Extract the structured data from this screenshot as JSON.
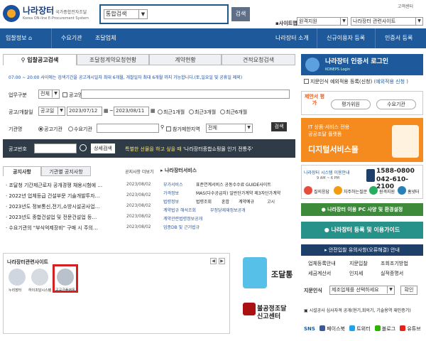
{
  "header": {
    "logo_title": "나라장터",
    "logo_subtitle": "국가종합전자조달",
    "logo_english": "Korea ON-line E-Procurement System",
    "search_select": "통합검색",
    "search_button": "검색",
    "customer_center": "고객센터",
    "sitemap": "사이트맵",
    "remote_support": "원격지원",
    "related_sites": "나라장터 관련사이트"
  },
  "nav": {
    "items": [
      "입찰정보",
      "수요기관",
      "조달업체"
    ],
    "right_items": [
      "나라장터 소개",
      "신규이용자 등록",
      "인증서 등록"
    ]
  },
  "main": {
    "tabs": [
      "입찰공고검색",
      "조달청계약요청현황",
      "계약현황",
      "견적요청검색"
    ],
    "notice_line": "07:00 ~ 20:00 사이에는 검색기간을 공고게시일자 최대 6개월, 개찰일자 최대 6개월 까지 가능합니다.(토,일요일 및 공휴일 제외)",
    "form": {
      "business_label": "업무구분",
      "business_value": "전체",
      "notice_name_label": "공고명",
      "date_label": "공고/개찰일",
      "date_type": "공고일",
      "date_from": "2023/07/12",
      "date_to": "2023/08/11",
      "range_1": "최근1개월",
      "range_3": "최근3개월",
      "range_6": "최근6개월",
      "agency_label": "기관명",
      "agency_radio_1": "공고기관",
      "agency_radio_2": "수요기관",
      "region_label": "참가제한지역",
      "region_value": "전체",
      "search_button": "검색"
    },
    "bid_bar": {
      "label": "공고번호",
      "detail_button": "상세검색",
      "promo": "특별한 선물을 하고 싶을 때",
      "promo_highlight": "'나라장터종합쇼핑몰 인기 전통주'"
    },
    "notice_tabs": [
      "공지사항",
      "기관별 공지사항"
    ],
    "notice_more": "공지사항 더보기",
    "notices": [
      {
        "title": "· 조달청 기간제근로자 공개경쟁 채용시험에 …",
        "date": "2023/08/02"
      },
      {
        "title": "· 2022년 업체등급 건설부문 기술개발투자…",
        "date": "2023/08/02"
      },
      {
        "title": "· 2023년도 정보통신,전기,소방시설공사업…",
        "date": "2023/08/02"
      },
      {
        "title": "· 2023년도 종합건설업 및 전문건설업 등…",
        "date": "2023/08/02"
      },
      {
        "title": "· 수요기관의 \"부식억제장비\" 구매 시 주의…",
        "date": "2023/08/02"
      }
    ],
    "services_title": "나라장터서비스",
    "services_left": [
      "부가서비스",
      "가격정보",
      "법령정보",
      "계약법규 해석조회",
      "계약관련법령정보공개",
      "업종DB 및 근거법규"
    ],
    "services_right": [
      "표준연계서비스 공동수수료 GUIDE사이트",
      "MAS(다수공급자) 일반단가계약 제3자단가계약",
      "법령조회",
      "혼합",
      "계약예규",
      "고시",
      "부정당제재정보공개"
    ]
  },
  "related": {
    "title": "나라장터관련사이트",
    "sites": [
      "누리장터",
      "하이조달시스템",
      "공공급플랫폼"
    ]
  },
  "promos": {
    "jodal": "조달통",
    "fair_line1": "불공정조달",
    "fair_line2": "신고센터"
  },
  "right": {
    "cert_title": "나라장터 인증서 로그인",
    "cert_sub": "KONEPS Login",
    "cert_row": "지문인식 예외적용 등록(신청)",
    "cert_row_extra": "(예외적용 신청 )",
    "eval_title": "제안서 평가",
    "eval_btn1": "평가위원",
    "eval_btn2": "수요기관",
    "digital_l1": "IT 상품·서비스 전용",
    "digital_l2": "공공조달 플랫폼",
    "digital_l3": "디지털서비스몰",
    "cs_title": "나라장터 시스템 이용안내",
    "cs_hours": "9 AM ~ 6 PM",
    "cs_phone1": "1588-0800",
    "cs_phone2": "042-610-2100",
    "cs_links": [
      "질의응답",
      "자주하는질문",
      "원격지원",
      "홈넷터"
    ],
    "bar_pc": "나라장터 이용 PC 사양 및 환경설정",
    "bar_register": "나라장터 등록 및 이용가이드",
    "bar_safety": "안전입찰 유의사항(오류해결) 안내",
    "util_links": [
      "업체등록안내",
      "지문입찰",
      "조회조기방법",
      "세금계산서",
      "인지세",
      "실적증명서"
    ],
    "cert_bottom_label": "지문인식",
    "cert_bottom_select": "제조업체를 선택하세요",
    "cert_bottom_confirm": "확인",
    "agency_line": "시설공사 심사자격 공개(현기,회의기, 기술용역 재인증기)",
    "sns_label": "SNS",
    "sns_items": [
      "페이스북",
      "트위터",
      "블로그",
      "유튜브"
    ]
  },
  "colors": {
    "nav_blue": "#1e5a9b",
    "promo_orange": "#f58a1f",
    "green_bar": "#3d8a3a",
    "teal_bar": "#27928a",
    "highlight_red": "#d42020"
  }
}
